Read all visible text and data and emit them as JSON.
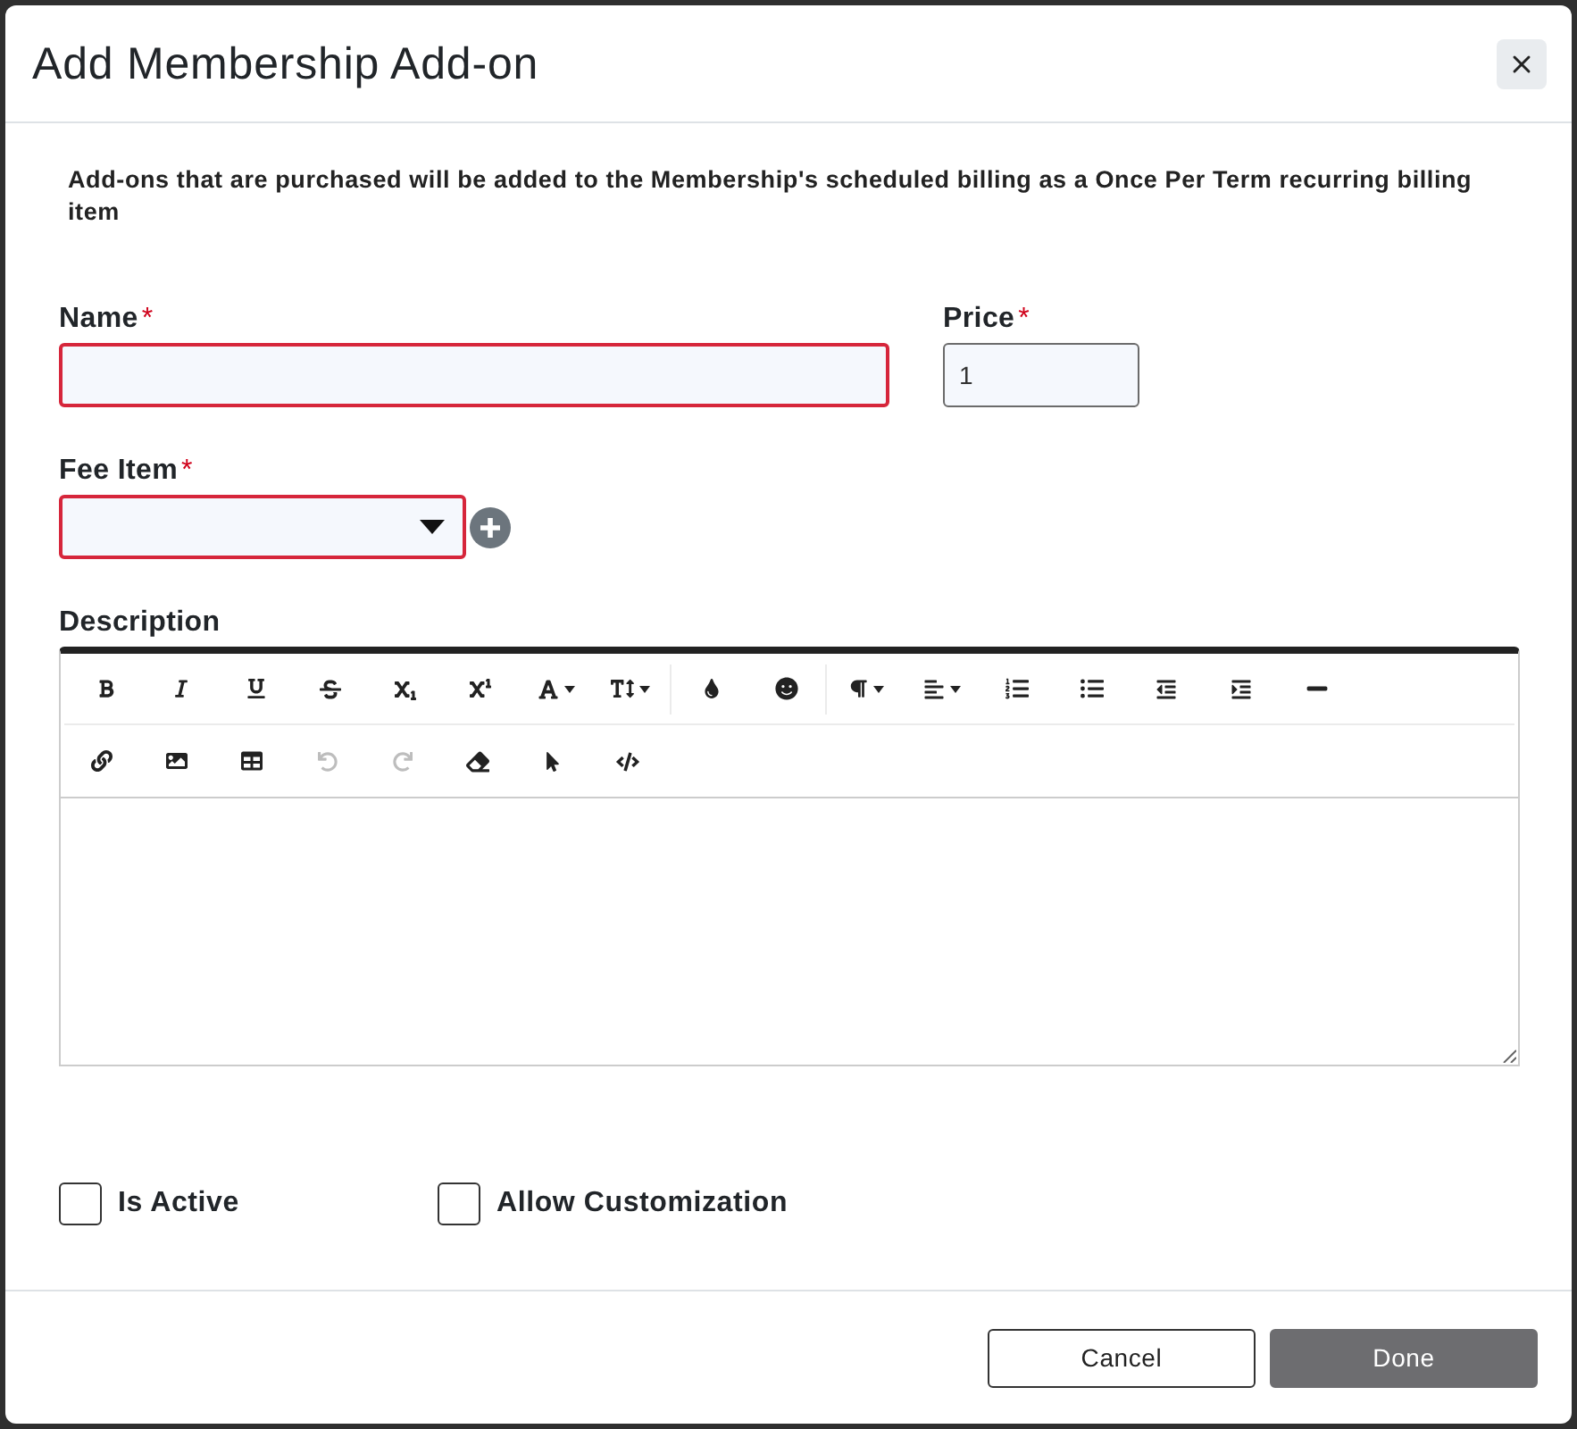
{
  "window": {
    "title": "Add Membership Add-on"
  },
  "intro": "Add-ons that are purchased will be added to the Membership's scheduled billing as a Once Per Term recurring billing item",
  "name_field": {
    "label": "Name",
    "required_mark": "*",
    "invalid": true
  },
  "price_field": {
    "label": "Price",
    "required_mark": "*",
    "invalid": false,
    "value": "1"
  },
  "fee_item_field": {
    "label": "Fee Item",
    "required_mark": "*",
    "invalid": true
  },
  "description": {
    "label": "Description",
    "toolbar": {
      "rows": [
        {
          "groups": [
            {
              "buttons": [
                {
                  "disabled": false
                },
                {
                  "disabled": false
                },
                {
                  "disabled": false
                },
                {
                  "disabled": false
                },
                {
                  "disabled": false
                },
                {
                  "disabled": false
                },
                {
                  "disabled": false
                },
                {
                  "disabled": false
                }
              ]
            },
            {
              "buttons": [
                {
                  "disabled": false
                },
                {
                  "disabled": false
                }
              ]
            },
            {
              "buttons": [
                {
                  "disabled": false
                },
                {
                  "disabled": false
                },
                {
                  "disabled": false
                },
                {
                  "disabled": false
                },
                {
                  "disabled": false
                },
                {
                  "disabled": false
                },
                {
                  "disabled": false
                }
              ]
            }
          ]
        },
        {
          "groups": [
            {
              "buttons": [
                {
                  "disabled": false
                },
                {
                  "disabled": false
                },
                {
                  "disabled": false
                },
                {
                  "disabled": true
                },
                {
                  "disabled": true
                },
                {
                  "disabled": false
                },
                {
                  "disabled": false
                },
                {
                  "disabled": false
                }
              ]
            }
          ]
        }
      ]
    }
  },
  "checkboxes": [
    {
      "label": "Is Active",
      "checked": false
    },
    {
      "label": "Allow Customization",
      "checked": false
    }
  ],
  "buttons": [
    {
      "label": "Cancel",
      "kind": "outline"
    },
    {
      "label": "Done",
      "kind": "filled"
    }
  ]
}
